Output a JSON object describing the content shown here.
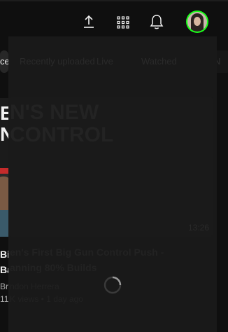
{
  "header": {
    "icons": [
      "upload-icon",
      "apps-grid-icon",
      "notifications-bell-icon",
      "avatar"
    ]
  },
  "chips": {
    "partial_left": "ce",
    "items": [
      "Recently uploaded",
      "Live",
      "Watched",
      "N"
    ]
  },
  "video": {
    "thumb_text_line1": "E",
    "thumb_text_line2": "N",
    "title_line1": "Bi",
    "title_line2": "Ba",
    "meta_line1": "Bra",
    "meta_line2": "11"
  },
  "overlay": {
    "thumb_line1": "N'S NEW",
    "thumb_line2": "CONTROL",
    "duration": "13:26",
    "title_line1": "en's First Big Gun Control Push -",
    "title_line2": "anning 80% Builds",
    "meta_line1": "ndon Herrera",
    "meta_line2": "K views • 1 day ago"
  },
  "colors": {
    "background": "#0f0f0f",
    "panel": "#191919",
    "avatar_ring": "#19ff19"
  }
}
